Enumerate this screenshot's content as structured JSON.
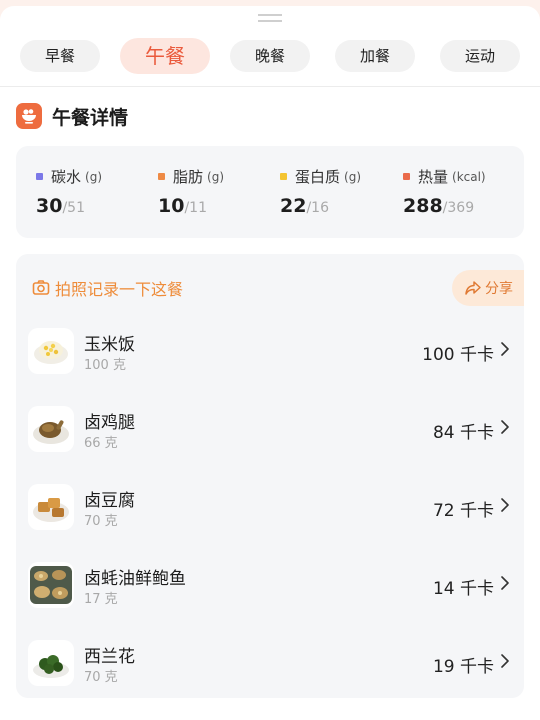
{
  "tabs": [
    {
      "label": "早餐"
    },
    {
      "label": "午餐"
    },
    {
      "label": "晚餐"
    },
    {
      "label": "加餐"
    },
    {
      "label": "运动"
    }
  ],
  "active_tab": "午餐",
  "section": {
    "title": "午餐详情",
    "icon": "meal-bowl-icon"
  },
  "macros": [
    {
      "label": "碳水",
      "unit": "(g)",
      "value": "30",
      "target": "/51",
      "color": "#7b78e8"
    },
    {
      "label": "脂肪",
      "unit": "(g)",
      "value": "10",
      "target": "/11",
      "color": "#ee8a45"
    },
    {
      "label": "蛋白质",
      "unit": "(g)",
      "value": "22",
      "target": "/16",
      "color": "#f4c431"
    },
    {
      "label": "热量",
      "unit": "(kcal)",
      "value": "288",
      "target": "/369",
      "color": "#ea6b4b"
    }
  ],
  "photo_prompt": {
    "text": "拍照记录一下这餐",
    "icon": "camera-icon"
  },
  "share": {
    "label": "分享",
    "icon": "share-arrow-icon"
  },
  "foods": [
    {
      "name": "玉米饭",
      "qty": "100 克",
      "kcal": "100 千卡"
    },
    {
      "name": "卤鸡腿",
      "qty": "66 克",
      "kcal": "84 千卡"
    },
    {
      "name": "卤豆腐",
      "qty": "70 克",
      "kcal": "72 千卡"
    },
    {
      "name": "卤蚝油鲜鲍鱼",
      "qty": "17 克",
      "kcal": "14 千卡"
    },
    {
      "name": "西兰花",
      "qty": "70 克",
      "kcal": "19 千卡"
    }
  ],
  "colors": {
    "accent": "#ea5a3c",
    "orange": "#ee8c3a",
    "card": "#f5f6f8"
  }
}
